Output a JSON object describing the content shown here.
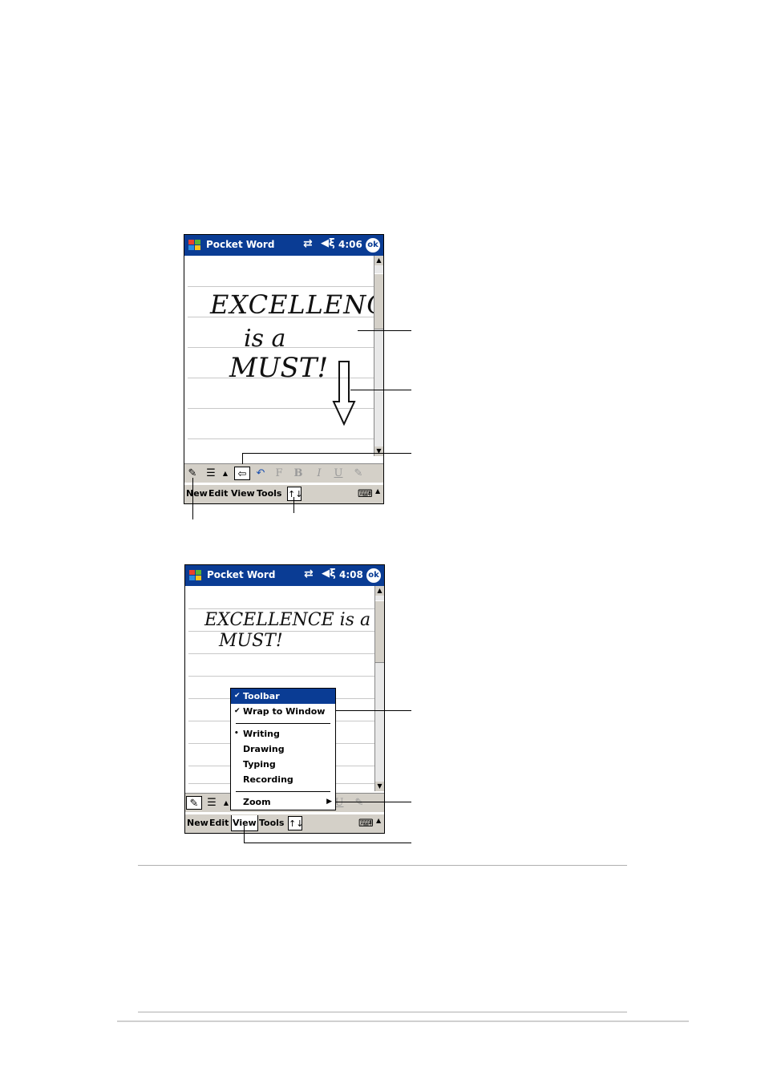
{
  "screen1": {
    "title": "Pocket Word",
    "time": "4:06",
    "ok_label": "ok",
    "handwriting": [
      "EXCELLENCE",
      "is a",
      "MUST!"
    ],
    "toolbar": {
      "pen": "✎",
      "lines": "☰",
      "up": "▲",
      "wrap": "⇦",
      "undo": "↶",
      "font": "F",
      "bold": "B",
      "italic": "I",
      "underline": "U",
      "highlight": "✎"
    },
    "menus": [
      "New",
      "Edit",
      "View",
      "Tools"
    ],
    "input_arrow": "↑↓",
    "keyboard": "⌨",
    "keyboard_arrow": "▲"
  },
  "screen2": {
    "title": "Pocket Word",
    "time": "4:08",
    "ok_label": "ok",
    "handwriting": [
      "EXCELLENCE is a",
      "MUST!"
    ],
    "view_menu": [
      {
        "label": "Toolbar",
        "mark": "✔"
      },
      {
        "label": "Wrap to Window",
        "mark": "✔"
      },
      {
        "label": "Writing",
        "mark": "•"
      },
      {
        "label": "Drawing",
        "mark": ""
      },
      {
        "label": "Typing",
        "mark": ""
      },
      {
        "label": "Recording",
        "mark": ""
      },
      {
        "label": "Zoom",
        "mark": "",
        "submenu": "▶"
      }
    ],
    "menus": [
      "New",
      "Edit",
      "View",
      "Tools"
    ],
    "input_arrow": "↑↓",
    "keyboard": "⌨",
    "keyboard_arrow": "▲"
  },
  "colors": {
    "titlebar": "#0a3c94",
    "chrome": "#d4d0c8"
  },
  "icons": [
    "windows-flag-icon",
    "connection-icon",
    "speaker-icon",
    "ok-icon",
    "keyboard-icon"
  ]
}
